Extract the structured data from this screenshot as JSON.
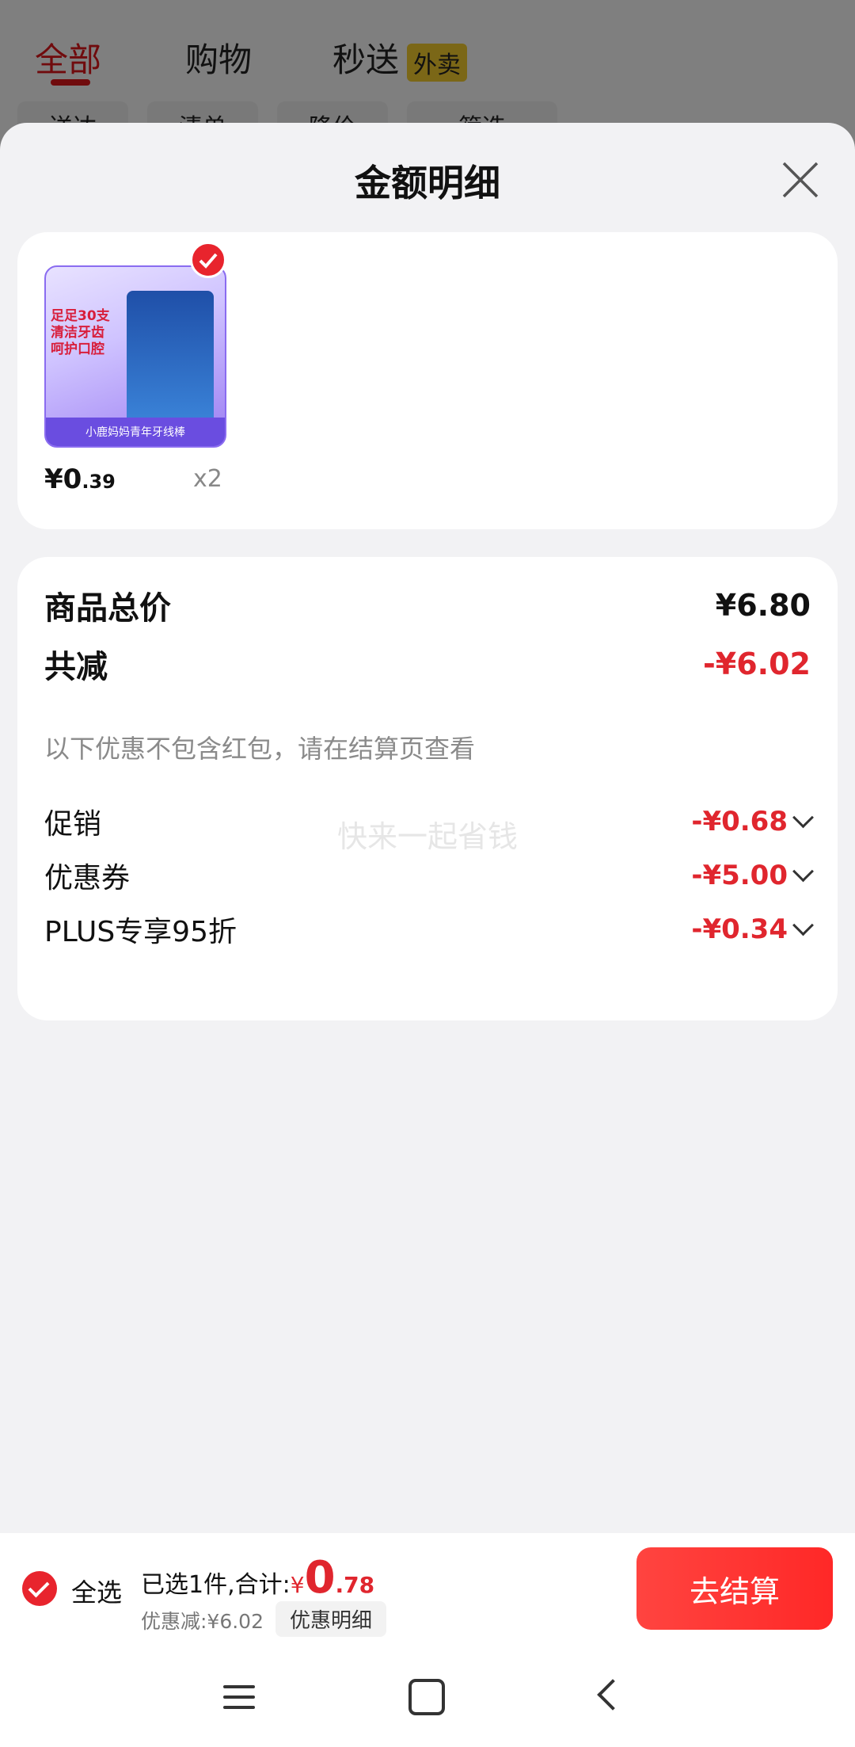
{
  "background": {
    "tabs": [
      "全部",
      "购物",
      "秒送"
    ],
    "waimai_badge": "外卖",
    "chips": [
      "送达",
      "清单",
      "降价",
      "筛选"
    ]
  },
  "sheet": {
    "title": "金额明细",
    "product": {
      "image_text_top": "足足30支\n清洁牙齿\n呵护口腔",
      "image_text_bottom": "小鹿妈妈青年牙线棒",
      "price_int": "¥0",
      "price_dec": ".39",
      "qty": "x2"
    },
    "details": {
      "total_label": "商品总价",
      "total_value": "¥6.80",
      "reduce_label": "共减",
      "reduce_value": "-¥6.02",
      "note": "以下优惠不包含红包，请在结算页查看",
      "watermark": "快来一起省钱",
      "items": [
        {
          "label": "促销",
          "value": "-¥0.68"
        },
        {
          "label": "优惠券",
          "value": "-¥5.00"
        },
        {
          "label": "PLUS专享95折",
          "value": "-¥0.34"
        }
      ]
    }
  },
  "footer": {
    "select_all": "全选",
    "selected_text": "已选1件,合计:",
    "currency": "¥",
    "amount_int": "0",
    "amount_dec": ".78",
    "discount_text": "优惠减:¥6.02",
    "detail_link": "优惠明细",
    "checkout": "去结算"
  },
  "colors": {
    "accent": "#e0262e",
    "brand_red": "#e8242d"
  }
}
